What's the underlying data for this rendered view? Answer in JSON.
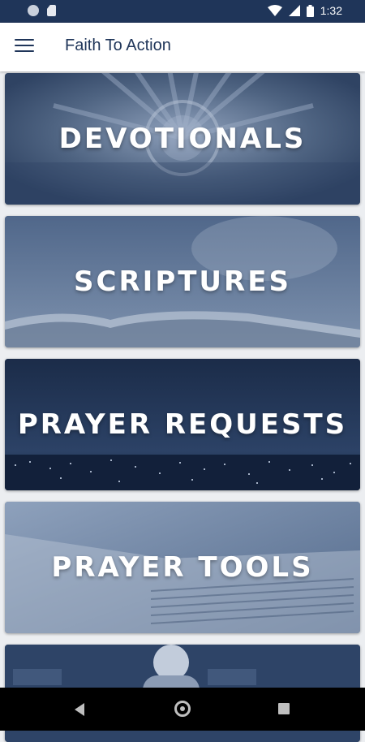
{
  "status_bar": {
    "time": "1:32",
    "icons": [
      "notification-dot-icon",
      "sd-card-icon",
      "wifi-icon",
      "signal-icon",
      "battery-icon"
    ]
  },
  "app_bar": {
    "title": "Faith To Action",
    "menu_icon": "hamburger-menu-icon"
  },
  "cards": [
    {
      "label": "DEVOTIONALS"
    },
    {
      "label": "SCRIPTURES"
    },
    {
      "label": "PRAYER REQUESTS"
    },
    {
      "label": "PRAYER TOOLS"
    },
    {
      "label": ""
    }
  ],
  "nav_bar": {
    "icons": [
      "back-icon",
      "home-icon",
      "recent-apps-icon"
    ]
  },
  "colors": {
    "status_bar": "#1f3559",
    "title_text": "#1f3559",
    "card_overlay": "#2b4468"
  }
}
